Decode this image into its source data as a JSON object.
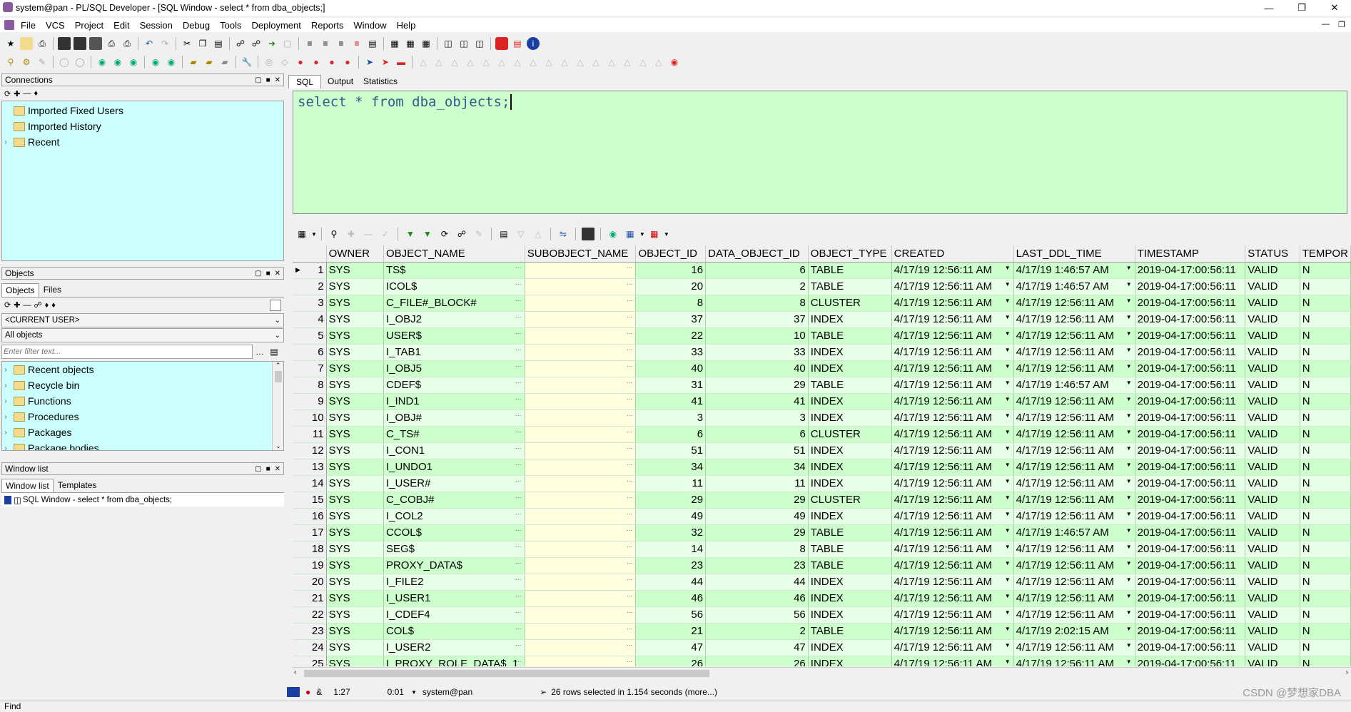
{
  "window": {
    "title": "system@pan - PL/SQL Developer - [SQL Window - select * from dba_objects;]"
  },
  "menu": [
    "File",
    "VCS",
    "Project",
    "Edit",
    "Session",
    "Debug",
    "Tools",
    "Deployment",
    "Reports",
    "Window",
    "Help"
  ],
  "connections": {
    "header": "Connections",
    "items": [
      {
        "label": "Imported Fixed Users"
      },
      {
        "label": "Imported History"
      },
      {
        "label": "Recent"
      }
    ]
  },
  "objects": {
    "header": "Objects",
    "tabs": [
      "Objects",
      "Files"
    ],
    "user_select": "<CURRENT USER>",
    "filter_select": "All objects",
    "filter_placeholder": "Enter filter text...",
    "items": [
      "Recent objects",
      "Recycle bin",
      "Functions",
      "Procedures",
      "Packages",
      "Package bodies"
    ]
  },
  "windowlist": {
    "header": "Window list",
    "tabs": [
      "Window list",
      "Templates"
    ],
    "item": "SQL Window - select * from dba_objects;"
  },
  "editor": {
    "tabs": [
      "SQL",
      "Output",
      "Statistics"
    ],
    "sql": "select * from dba_objects;"
  },
  "grid": {
    "columns": [
      "OWNER",
      "OBJECT_NAME",
      "SUBOBJECT_NAME",
      "OBJECT_ID",
      "DATA_OBJECT_ID",
      "OBJECT_TYPE",
      "CREATED",
      "LAST_DDL_TIME",
      "TIMESTAMP",
      "STATUS",
      "TEMPOR"
    ],
    "rows": [
      [
        "1",
        "SYS",
        "TS$",
        "",
        "16",
        "6",
        "TABLE",
        "4/17/19 12:56:11 AM",
        "4/17/19 1:46:57 AM",
        "2019-04-17:00:56:11",
        "VALID",
        "N"
      ],
      [
        "2",
        "SYS",
        "ICOL$",
        "",
        "20",
        "2",
        "TABLE",
        "4/17/19 12:56:11 AM",
        "4/17/19 1:46:57 AM",
        "2019-04-17:00:56:11",
        "VALID",
        "N"
      ],
      [
        "3",
        "SYS",
        "C_FILE#_BLOCK#",
        "",
        "8",
        "8",
        "CLUSTER",
        "4/17/19 12:56:11 AM",
        "4/17/19 12:56:11 AM",
        "2019-04-17:00:56:11",
        "VALID",
        "N"
      ],
      [
        "4",
        "SYS",
        "I_OBJ2",
        "",
        "37",
        "37",
        "INDEX",
        "4/17/19 12:56:11 AM",
        "4/17/19 12:56:11 AM",
        "2019-04-17:00:56:11",
        "VALID",
        "N"
      ],
      [
        "5",
        "SYS",
        "USER$",
        "",
        "22",
        "10",
        "TABLE",
        "4/17/19 12:56:11 AM",
        "4/17/19 12:56:11 AM",
        "2019-04-17:00:56:11",
        "VALID",
        "N"
      ],
      [
        "6",
        "SYS",
        "I_TAB1",
        "",
        "33",
        "33",
        "INDEX",
        "4/17/19 12:56:11 AM",
        "4/17/19 12:56:11 AM",
        "2019-04-17:00:56:11",
        "VALID",
        "N"
      ],
      [
        "7",
        "SYS",
        "I_OBJ5",
        "",
        "40",
        "40",
        "INDEX",
        "4/17/19 12:56:11 AM",
        "4/17/19 12:56:11 AM",
        "2019-04-17:00:56:11",
        "VALID",
        "N"
      ],
      [
        "8",
        "SYS",
        "CDEF$",
        "",
        "31",
        "29",
        "TABLE",
        "4/17/19 12:56:11 AM",
        "4/17/19 1:46:57 AM",
        "2019-04-17:00:56:11",
        "VALID",
        "N"
      ],
      [
        "9",
        "SYS",
        "I_IND1",
        "",
        "41",
        "41",
        "INDEX",
        "4/17/19 12:56:11 AM",
        "4/17/19 12:56:11 AM",
        "2019-04-17:00:56:11",
        "VALID",
        "N"
      ],
      [
        "10",
        "SYS",
        "I_OBJ#",
        "",
        "3",
        "3",
        "INDEX",
        "4/17/19 12:56:11 AM",
        "4/17/19 12:56:11 AM",
        "2019-04-17:00:56:11",
        "VALID",
        "N"
      ],
      [
        "11",
        "SYS",
        "C_TS#",
        "",
        "6",
        "6",
        "CLUSTER",
        "4/17/19 12:56:11 AM",
        "4/17/19 12:56:11 AM",
        "2019-04-17:00:56:11",
        "VALID",
        "N"
      ],
      [
        "12",
        "SYS",
        "I_CON1",
        "",
        "51",
        "51",
        "INDEX",
        "4/17/19 12:56:11 AM",
        "4/17/19 12:56:11 AM",
        "2019-04-17:00:56:11",
        "VALID",
        "N"
      ],
      [
        "13",
        "SYS",
        "I_UNDO1",
        "",
        "34",
        "34",
        "INDEX",
        "4/17/19 12:56:11 AM",
        "4/17/19 12:56:11 AM",
        "2019-04-17:00:56:11",
        "VALID",
        "N"
      ],
      [
        "14",
        "SYS",
        "I_USER#",
        "",
        "11",
        "11",
        "INDEX",
        "4/17/19 12:56:11 AM",
        "4/17/19 12:56:11 AM",
        "2019-04-17:00:56:11",
        "VALID",
        "N"
      ],
      [
        "15",
        "SYS",
        "C_COBJ#",
        "",
        "29",
        "29",
        "CLUSTER",
        "4/17/19 12:56:11 AM",
        "4/17/19 12:56:11 AM",
        "2019-04-17:00:56:11",
        "VALID",
        "N"
      ],
      [
        "16",
        "SYS",
        "I_COL2",
        "",
        "49",
        "49",
        "INDEX",
        "4/17/19 12:56:11 AM",
        "4/17/19 12:56:11 AM",
        "2019-04-17:00:56:11",
        "VALID",
        "N"
      ],
      [
        "17",
        "SYS",
        "CCOL$",
        "",
        "32",
        "29",
        "TABLE",
        "4/17/19 12:56:11 AM",
        "4/17/19 1:46:57 AM",
        "2019-04-17:00:56:11",
        "VALID",
        "N"
      ],
      [
        "18",
        "SYS",
        "SEG$",
        "",
        "14",
        "8",
        "TABLE",
        "4/17/19 12:56:11 AM",
        "4/17/19 12:56:11 AM",
        "2019-04-17:00:56:11",
        "VALID",
        "N"
      ],
      [
        "19",
        "SYS",
        "PROXY_DATA$",
        "",
        "23",
        "23",
        "TABLE",
        "4/17/19 12:56:11 AM",
        "4/17/19 12:56:11 AM",
        "2019-04-17:00:56:11",
        "VALID",
        "N"
      ],
      [
        "20",
        "SYS",
        "I_FILE2",
        "",
        "44",
        "44",
        "INDEX",
        "4/17/19 12:56:11 AM",
        "4/17/19 12:56:11 AM",
        "2019-04-17:00:56:11",
        "VALID",
        "N"
      ],
      [
        "21",
        "SYS",
        "I_USER1",
        "",
        "46",
        "46",
        "INDEX",
        "4/17/19 12:56:11 AM",
        "4/17/19 12:56:11 AM",
        "2019-04-17:00:56:11",
        "VALID",
        "N"
      ],
      [
        "22",
        "SYS",
        "I_CDEF4",
        "",
        "56",
        "56",
        "INDEX",
        "4/17/19 12:56:11 AM",
        "4/17/19 12:56:11 AM",
        "2019-04-17:00:56:11",
        "VALID",
        "N"
      ],
      [
        "23",
        "SYS",
        "COL$",
        "",
        "21",
        "2",
        "TABLE",
        "4/17/19 12:56:11 AM",
        "4/17/19 2:02:15 AM",
        "2019-04-17:00:56:11",
        "VALID",
        "N"
      ],
      [
        "24",
        "SYS",
        "I_USER2",
        "",
        "47",
        "47",
        "INDEX",
        "4/17/19 12:56:11 AM",
        "4/17/19 12:56:11 AM",
        "2019-04-17:00:56:11",
        "VALID",
        "N"
      ],
      [
        "25",
        "SYS",
        "I_PROXY_ROLE_DATA$_1",
        "",
        "26",
        "26",
        "INDEX",
        "4/17/19 12:56:11 AM",
        "4/17/19 12:56:11 AM",
        "2019-04-17:00:56:11",
        "VALID",
        "N"
      ]
    ]
  },
  "status": {
    "position": "1:27",
    "time": "0:01",
    "connection": "system@pan",
    "message": "26 rows selected in 1.154 seconds (more...)"
  },
  "watermark": "CSDN @梦想家DBA",
  "find": "Find"
}
